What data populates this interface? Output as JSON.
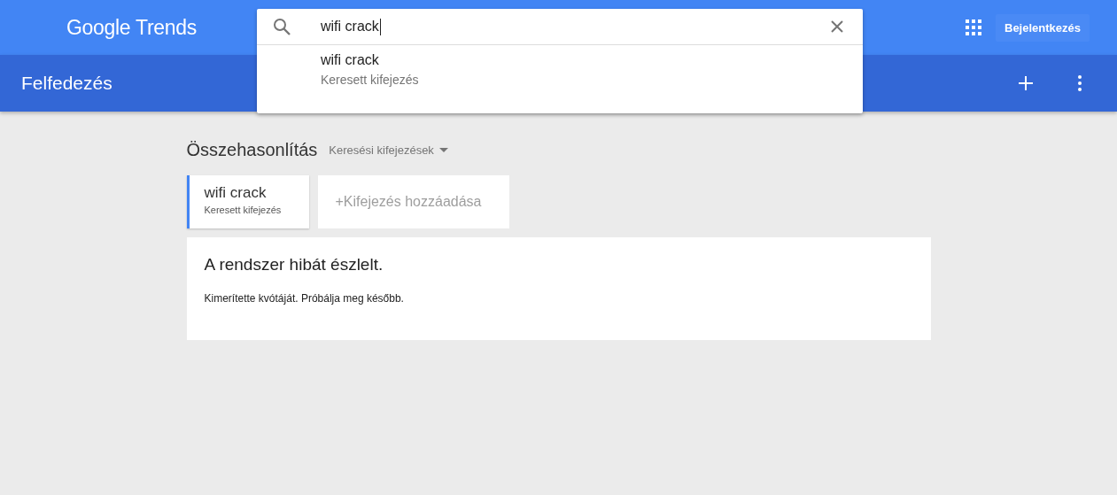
{
  "header": {
    "logo": "Google Trends",
    "sign_in": "Bejelentkezés"
  },
  "subheader": {
    "title": "Felfedezés"
  },
  "search": {
    "value": "wifi crack",
    "suggestions": [
      {
        "title": "wifi crack",
        "subtitle": "Keresett kifejezés"
      }
    ]
  },
  "compare": {
    "title": "Összehasonlítás",
    "dropdown": "Keresési kifejezések"
  },
  "terms": [
    {
      "title": "wifi crack",
      "subtitle": "Keresett kifejezés",
      "color": "#4285f4"
    }
  ],
  "add_term": "+Kifejezés hozzáadása",
  "error": {
    "title": "A rendszer hibát észlelt.",
    "message": "Kimerítette kvótáját. Próbálja meg később."
  }
}
